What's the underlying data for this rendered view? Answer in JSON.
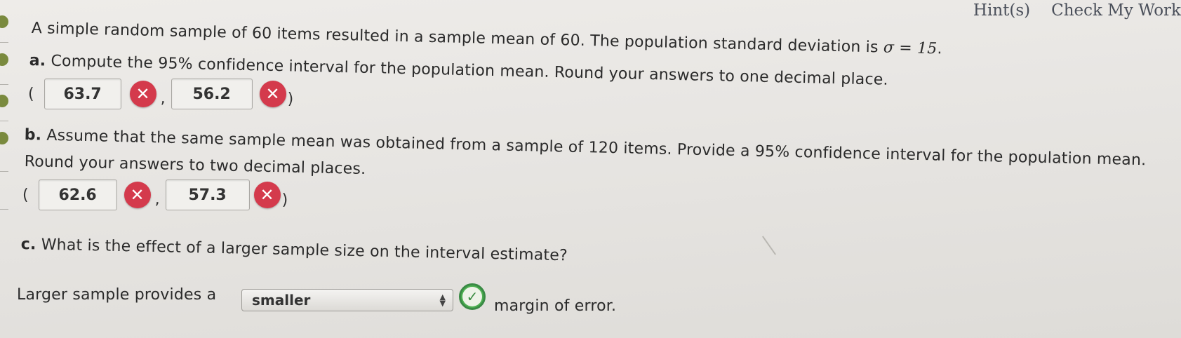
{
  "header": {
    "hint_label": "Hint(s)",
    "check_label": "Check My Work"
  },
  "problem": {
    "intro_before": "A simple random sample of 60 items resulted in a sample mean of 60. The population standard deviation is ",
    "intro_sigma": "σ = 15",
    "intro_after": "."
  },
  "part_a": {
    "label": "a.",
    "text": "Compute the 95% confidence interval for the population mean. Round your answers to one decimal place.",
    "open_paren": "(",
    "comma": ",",
    "close_paren": ")",
    "lower_value": "63.7",
    "upper_value": "56.2",
    "lower_status": "incorrect",
    "upper_status": "incorrect"
  },
  "part_b": {
    "label": "b.",
    "text_line1": "Assume that the same sample mean was obtained from a sample of 120 items. Provide a 95% confidence interval for the population mean.",
    "text_line2": "Round your answers to two decimal places.",
    "open_paren": "(",
    "comma": ",",
    "close_paren": ")",
    "lower_value": "62.6",
    "upper_value": "57.3",
    "lower_status": "incorrect",
    "upper_status": "incorrect"
  },
  "part_c": {
    "label": "c.",
    "text": "What is the effect of a larger sample size on the interval estimate?",
    "sentence_before": "Larger sample provides a",
    "select_value": "smaller",
    "sentence_after": "margin of error.",
    "select_status": "correct"
  },
  "icons": {
    "wrong": "close-circle-icon",
    "correct": "check-circle-icon",
    "select_arrows": "updown-arrows-icon"
  },
  "colors": {
    "incorrect": "#d43a4c",
    "correct": "#4caf50",
    "link": "#4a4f5a"
  }
}
